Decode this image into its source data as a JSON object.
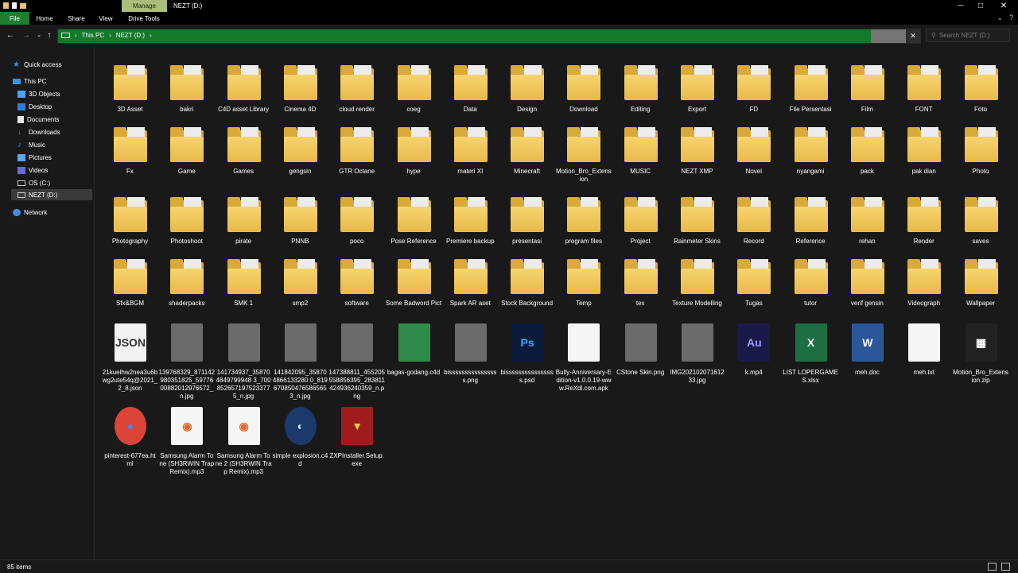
{
  "window": {
    "title": "NEZT (D:)",
    "manage_tab": "Manage",
    "controls": {
      "minimize": "─",
      "maximize": "□",
      "close": "✕"
    }
  },
  "ribbon": {
    "tabs": [
      "File",
      "Home",
      "Share",
      "View",
      "Drive Tools"
    ]
  },
  "address": {
    "crumbs": [
      "This PC",
      "NEZT (D:)"
    ],
    "search_placeholder": "Search NEZT (D:)"
  },
  "sidebar": {
    "items": [
      {
        "label": "Quick access",
        "icon": "star-icon"
      },
      {
        "label": "This PC",
        "icon": "pc-icon"
      },
      {
        "label": "3D Objects",
        "icon": "cube-icon"
      },
      {
        "label": "Desktop",
        "icon": "desktop-icon"
      },
      {
        "label": "Documents",
        "icon": "documents-icon"
      },
      {
        "label": "Downloads",
        "icon": "downloads-icon"
      },
      {
        "label": "Music",
        "icon": "music-icon"
      },
      {
        "label": "Pictures",
        "icon": "pictures-icon"
      },
      {
        "label": "Videos",
        "icon": "videos-icon"
      },
      {
        "label": "OS (C:)",
        "icon": "drive-icon"
      },
      {
        "label": "NEZT (D:)",
        "icon": "drive-icon"
      },
      {
        "label": "Network",
        "icon": "network-icon"
      }
    ]
  },
  "files": [
    {
      "name": "3D Asset",
      "kind": "folder"
    },
    {
      "name": "bakri",
      "kind": "folder"
    },
    {
      "name": "C4D asset Library",
      "kind": "folder"
    },
    {
      "name": "Cinema 4D",
      "kind": "folder"
    },
    {
      "name": "cloud render",
      "kind": "folder"
    },
    {
      "name": "coeg",
      "kind": "folder"
    },
    {
      "name": "Data",
      "kind": "folder"
    },
    {
      "name": "Design",
      "kind": "folder"
    },
    {
      "name": "Download",
      "kind": "folder"
    },
    {
      "name": "Editing",
      "kind": "folder"
    },
    {
      "name": "Export",
      "kind": "folder"
    },
    {
      "name": "FD",
      "kind": "folder"
    },
    {
      "name": "File Persentasi",
      "kind": "folder"
    },
    {
      "name": "Film",
      "kind": "folder"
    },
    {
      "name": "FONT",
      "kind": "folder"
    },
    {
      "name": "Foto",
      "kind": "folder"
    },
    {
      "name": "Fx",
      "kind": "folder"
    },
    {
      "name": "Game",
      "kind": "folder"
    },
    {
      "name": "Games",
      "kind": "folder"
    },
    {
      "name": "gengsin",
      "kind": "folder"
    },
    {
      "name": "GTR Octane",
      "kind": "folder"
    },
    {
      "name": "hype",
      "kind": "folder"
    },
    {
      "name": "materi XI",
      "kind": "folder"
    },
    {
      "name": "Minecraft",
      "kind": "folder"
    },
    {
      "name": "Motion_Bro_Extension",
      "kind": "folder"
    },
    {
      "name": "MUSIC",
      "kind": "folder"
    },
    {
      "name": "NEZT XMP",
      "kind": "folder"
    },
    {
      "name": "Novel",
      "kind": "folder"
    },
    {
      "name": "nyangami",
      "kind": "folder"
    },
    {
      "name": "pack",
      "kind": "folder"
    },
    {
      "name": "pak dian",
      "kind": "folder"
    },
    {
      "name": "Photo",
      "kind": "folder"
    },
    {
      "name": "Photography",
      "kind": "folder"
    },
    {
      "name": "Photoshoot",
      "kind": "folder"
    },
    {
      "name": "pirate",
      "kind": "folder"
    },
    {
      "name": "PNNB",
      "kind": "folder"
    },
    {
      "name": "poco",
      "kind": "folder"
    },
    {
      "name": "Pose Reference",
      "kind": "folder"
    },
    {
      "name": "Premiere backup",
      "kind": "folder"
    },
    {
      "name": "presentasi",
      "kind": "folder"
    },
    {
      "name": "program files",
      "kind": "folder"
    },
    {
      "name": "Project",
      "kind": "folder"
    },
    {
      "name": "Rainmeter Skins",
      "kind": "folder"
    },
    {
      "name": "Record",
      "kind": "folder"
    },
    {
      "name": "Reference",
      "kind": "folder"
    },
    {
      "name": "rehan",
      "kind": "folder"
    },
    {
      "name": "Render",
      "kind": "folder"
    },
    {
      "name": "saves",
      "kind": "folder"
    },
    {
      "name": "Sfx&BGM",
      "kind": "folder"
    },
    {
      "name": "shaderpacks",
      "kind": "folder"
    },
    {
      "name": "SMK 1",
      "kind": "folder"
    },
    {
      "name": "smp2",
      "kind": "folder"
    },
    {
      "name": "software",
      "kind": "folder"
    },
    {
      "name": "Some Badword Pict",
      "kind": "folder"
    },
    {
      "name": "Spark AR aset",
      "kind": "folder"
    },
    {
      "name": "Stock Background",
      "kind": "folder"
    },
    {
      "name": "Temp",
      "kind": "folder"
    },
    {
      "name": "tex",
      "kind": "folder"
    },
    {
      "name": "Texture Modelling",
      "kind": "folder"
    },
    {
      "name": "Tugas",
      "kind": "folder"
    },
    {
      "name": "tutor",
      "kind": "folder"
    },
    {
      "name": "verif gensin",
      "kind": "folder"
    },
    {
      "name": "Videograph",
      "kind": "folder"
    },
    {
      "name": "Wallpaper",
      "kind": "folder"
    },
    {
      "name": "21kuelhw2nea3u6bwg2ute54q@2021_2_8.json",
      "kind": "json"
    },
    {
      "name": "139768329_871142980351825_5977600882012976572_n.jpg",
      "kind": "image"
    },
    {
      "name": "141734937_358704849799948 3_700852657197523377 5_n.jpg",
      "kind": "image"
    },
    {
      "name": "141842095_358704866133280 0_819670850476586565 3_n.jpg",
      "kind": "image"
    },
    {
      "name": "147388811_455205558856395_283811424936240359_n.png",
      "kind": "image"
    },
    {
      "name": "bagas-godang.c4d",
      "kind": "c4d"
    },
    {
      "name": "bissssssssssssssss.png",
      "kind": "image"
    },
    {
      "name": "bissssssssssssssss.psd",
      "kind": "psd"
    },
    {
      "name": "Bully-Anniversary-Edition-v1.0.0.19-www.ReXdl.com.apk",
      "kind": "blank"
    },
    {
      "name": "CStone Skin.png",
      "kind": "image"
    },
    {
      "name": "IMG20210207161233.jpg",
      "kind": "image"
    },
    {
      "name": "k.mp4",
      "kind": "audition"
    },
    {
      "name": "LIST LOPERGAMES.xlsx",
      "kind": "excel"
    },
    {
      "name": "meh.doc",
      "kind": "word"
    },
    {
      "name": "meh.txt",
      "kind": "text"
    },
    {
      "name": "Motion_Bro_Extension.zip",
      "kind": "zip"
    },
    {
      "name": "pinterest-677ea.html",
      "kind": "chrome"
    },
    {
      "name": "Samsung Alarm Tone (SH3RWIN Trap Remix).mp3",
      "kind": "audio"
    },
    {
      "name": "Samsung Alarm Tone 2 (SH3RWIN Trap Remix).mp3",
      "kind": "audio"
    },
    {
      "name": "simple explosion.c4d",
      "kind": "cinema"
    },
    {
      "name": "ZXPInstaller.Setup.exe",
      "kind": "installer"
    }
  ],
  "labels_display": [
    "3D Asset",
    "bakri",
    "C4D asset Library",
    "Cinema 4D",
    "cloud render",
    "coeg",
    "Data",
    "Design",
    "Download",
    "Editing",
    "Export",
    "FD",
    "File Persentasi",
    "Film",
    "FONT",
    "Foto",
    "Fx",
    "Game",
    "Games",
    "gengsin",
    "GTR Octane",
    "hype",
    "materi XI",
    "Minecraft",
    "Motion_Bro_Extension",
    "MUSIC",
    "NEZT XMP",
    "Novel",
    "nyangami",
    "pack",
    "pak dian",
    "Photo",
    "Photography",
    "Photoshoot",
    "pirate",
    "PNNB",
    "poco",
    "Pose Reference",
    "Premiere backup",
    "presentasi",
    "program files",
    "Project",
    "Rainmeter Skins",
    "Record",
    "Reference",
    "rehan",
    "Render",
    "saves",
    "Sfx&BGM",
    "shaderpacks",
    "SMK 1",
    "smp2",
    "software",
    "Some Badword Pict",
    "Spark AR aset",
    "Stock Background",
    "Temp",
    "tex",
    "Texture Modelling",
    "Tugas",
    "tutor",
    "verif gensin",
    "Videograph",
    "Wallpaper"
  ],
  "status": {
    "count": "85 items"
  },
  "colors": {
    "accent_green": "#137a2a",
    "file_tab": "#1e7d2e",
    "manage_tab": "#aabd7a",
    "folder": "#e8b94a"
  }
}
